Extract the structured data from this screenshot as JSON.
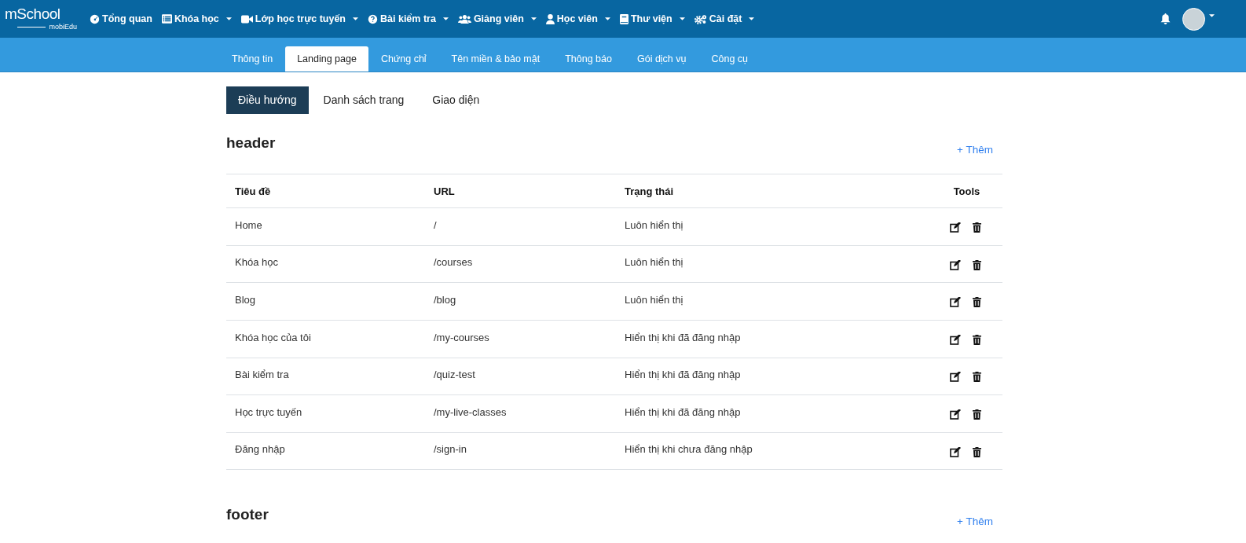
{
  "logo": {
    "brand": "mSchool",
    "sub": "mobiEdu"
  },
  "nav": [
    {
      "label": "Tổng quan",
      "dropdown": false
    },
    {
      "label": "Khóa học",
      "dropdown": true
    },
    {
      "label": "Lớp học trực tuyến",
      "dropdown": true
    },
    {
      "label": "Bài kiểm tra",
      "dropdown": true
    },
    {
      "label": "Giảng viên",
      "dropdown": true
    },
    {
      "label": "Học viên",
      "dropdown": true
    },
    {
      "label": "Thư viện",
      "dropdown": true
    },
    {
      "label": "Cài đặt",
      "dropdown": true
    }
  ],
  "tabs": [
    {
      "label": "Thông tin",
      "selected": false
    },
    {
      "label": "Landing page",
      "selected": true
    },
    {
      "label": "Chứng chỉ",
      "selected": false
    },
    {
      "label": "Tên miền & bảo mật",
      "selected": false
    },
    {
      "label": "Thông báo",
      "selected": false
    },
    {
      "label": "Gói dịch vụ",
      "selected": false
    },
    {
      "label": "Công cụ",
      "selected": false
    }
  ],
  "subtabs": [
    {
      "label": "Điều hướng",
      "selected": true
    },
    {
      "label": "Danh sách trang",
      "selected": false
    },
    {
      "label": "Giao diện",
      "selected": false
    }
  ],
  "sections": [
    {
      "title": "header",
      "add_button": "+ Thêm",
      "columns": [
        "Tiêu đề",
        "URL",
        "Trạng thái",
        "Tools"
      ],
      "rows": [
        {
          "title": "Home",
          "url": "/",
          "status": "Luôn hiển thị"
        },
        {
          "title": "Khóa học",
          "url": "/courses",
          "status": "Luôn hiển thị"
        },
        {
          "title": "Blog",
          "url": "/blog",
          "status": "Luôn hiển thị"
        },
        {
          "title": "Khóa học của tôi",
          "url": "/my-courses",
          "status": "Hiển thị khi đã đăng nhập"
        },
        {
          "title": "Bài kiểm tra",
          "url": "/quiz-test",
          "status": "Hiển thị khi đã đăng nhập"
        },
        {
          "title": "Học trực tuyến",
          "url": "/my-live-classes",
          "status": "Hiển thị khi đã đăng nhập"
        },
        {
          "title": "Đăng nhập",
          "url": "/sign-in",
          "status": "Hiển thị khi chưa đăng nhập"
        }
      ]
    },
    {
      "title": "footer",
      "add_button": "+ Thêm"
    }
  ]
}
